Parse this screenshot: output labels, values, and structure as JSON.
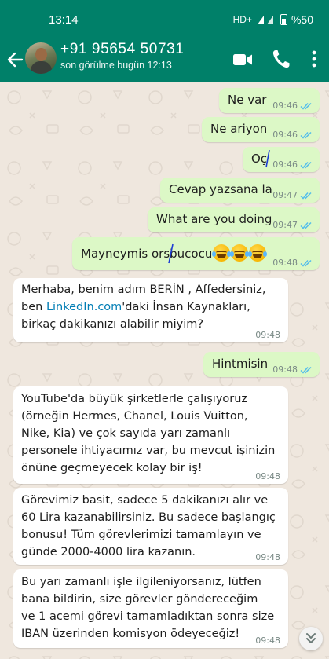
{
  "status_bar": {
    "time": "13:14",
    "network": "HD+",
    "signal_label": "4G",
    "battery": "%50"
  },
  "header": {
    "contact_name": "+91 95654 50731",
    "last_seen": "son görülme bugün 12:13",
    "icons": [
      "back-arrow-icon",
      "video-call-icon",
      "voice-call-icon",
      "more-options-icon"
    ]
  },
  "messages": [
    {
      "dir": "out",
      "text": "Ne var",
      "time": "09:46",
      "read": true
    },
    {
      "dir": "out",
      "text": "Ne ariyon",
      "time": "09:46",
      "read": true
    },
    {
      "dir": "out",
      "text": "Oç",
      "time": "09:46",
      "read": true
    },
    {
      "dir": "out",
      "text": "Cevap yazsana la",
      "time": "09:47",
      "read": true
    },
    {
      "dir": "out",
      "text": "What are you doing",
      "time": "09:47",
      "read": true
    },
    {
      "dir": "out",
      "text": "Mayneymis orsbucocu",
      "emoji": "rolling-on-the-floor-laughing x3",
      "time": "09:48",
      "read": true
    },
    {
      "dir": "in",
      "text_before_link": "Merhaba, benim adım BERİN , Affedersiniz,\nben ",
      "link": "LinkedIn.com",
      "text_after_link": "'daki İnsan Kaynakları,\nbirkaç dakikanızı alabilir miyim?",
      "time": "09:48"
    },
    {
      "dir": "out",
      "text": "Hintmisin",
      "time": "09:48",
      "read": true
    },
    {
      "dir": "in",
      "text": "YouTube'da büyük şirketlerle çalışıyoruz\n(örneğin Hermes, Chanel, Louis Vuitton,\nNike, Kia) ve çok sayıda yarı zamanlı\npersonele ihtiyacımız var, bu mevcut işinizin\nönüne geçmeyecek kolay bir iş!",
      "time": "09:48"
    },
    {
      "dir": "in",
      "text": "Görevimiz basit, sadece 5 dakikanızı alır ve\n60 Lira kazanabilirsiniz. Bu sadece başlangıç\nbonusu! Tüm görevlerimizi tamamlayın ve\ngünde 2000-4000 lira kazanın.",
      "time": "09:48"
    },
    {
      "dir": "in",
      "text": "Bu yarı zamanlı işle ilgileniyorsanız, lütfen\nbana bildirin, size görevler göndereceğim\nve 1 acemi görevi tamamladıktan sonra size\nIBAN üzerinden komisyon ödeyeceğiz!",
      "time": "09:48"
    }
  ],
  "colors": {
    "header": "#008069",
    "outgoing_bubble": "#dcf8c6",
    "incoming_bubble": "#ffffff",
    "read_tick": "#53bdeb",
    "link": "#027eb5",
    "chat_background": "#efe7de"
  }
}
